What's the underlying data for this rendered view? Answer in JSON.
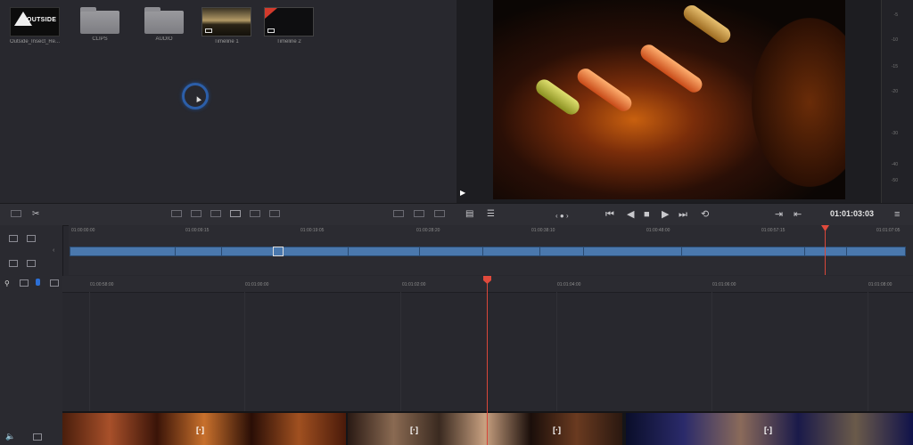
{
  "media_pool": {
    "clips": [
      {
        "label": "Outside_Insect_Re...",
        "type": "video",
        "thumb_text": "OUTSIDE"
      },
      {
        "label": "CLIPS",
        "type": "folder"
      },
      {
        "label": "AUDIO",
        "type": "folder"
      },
      {
        "label": "Timeline 1",
        "type": "timeline"
      },
      {
        "label": "Timeline 2",
        "type": "timeline"
      }
    ]
  },
  "audio_meter": {
    "ticks": [
      "-5",
      "-10",
      "-15",
      "-20",
      "-30",
      "-40",
      "-50"
    ]
  },
  "transport": {
    "timecode": "01:01:03:03",
    "nav_icons": [
      "first-frame",
      "step-back",
      "stop",
      "play",
      "fast-forward",
      "loop"
    ]
  },
  "upper_timeline": {
    "ruler": [
      "01:00:00:00",
      "01:00:09:15",
      "01:00:19:05",
      "01:00:28:20",
      "01:00:38:10",
      "01:00:48:00",
      "01:00:57:15",
      "01:01:07:05"
    ]
  },
  "lower_timeline": {
    "ruler": [
      "01:00:58:00",
      "01:01:00:00",
      "01:01:02:00",
      "01:01:04:00",
      "01:01:06:00",
      "01:01:08:00"
    ]
  },
  "colors": {
    "playhead": "#d9473a",
    "clip_blue": "#4a78ad",
    "spinner": "#2c5ea8"
  }
}
